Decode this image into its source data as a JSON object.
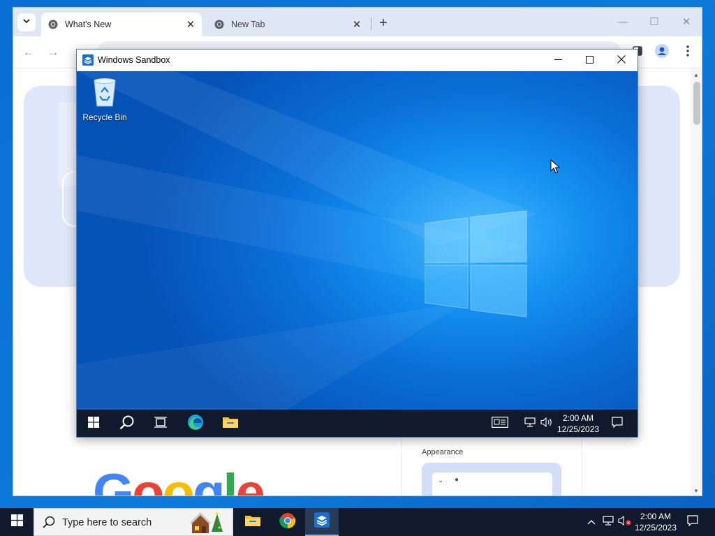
{
  "chrome": {
    "tabs": [
      {
        "title": "What's New"
      },
      {
        "title": "New Tab"
      }
    ],
    "content": {
      "appearance_label": "Appearance",
      "logo_text": "Google"
    }
  },
  "sandbox": {
    "title": "Windows Sandbox",
    "desktop_icons": [
      {
        "label": "Recycle Bin",
        "icon": "recycle-bin-icon"
      }
    ],
    "taskbar": {
      "clock_time": "2:00 AM",
      "clock_date": "12/25/2023",
      "apps": [
        "start-icon",
        "search-icon",
        "task-view-icon",
        "edge-icon",
        "file-explorer-icon"
      ]
    }
  },
  "host_taskbar": {
    "search_placeholder": "Type here to search",
    "clock_time": "2:00 AM",
    "clock_date": "12/25/2023",
    "apps": [
      "file-explorer-icon",
      "chrome-icon",
      "windows-sandbox-icon"
    ],
    "active_app": "windows-sandbox-icon"
  },
  "colors": {
    "desktop_blue": "#0a6fd6",
    "taskbar": "#101a2c",
    "chrome_tabstrip": "#dfe6f4",
    "hero_card": "#dfe7fa"
  }
}
